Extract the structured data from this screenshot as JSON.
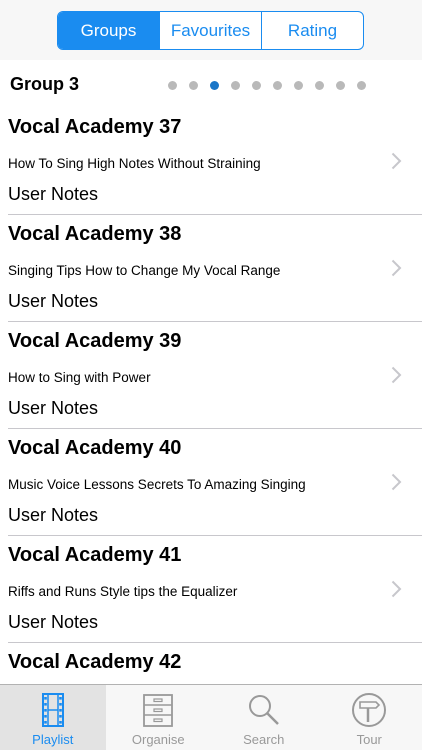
{
  "segments": [
    {
      "label": "Groups",
      "active": true
    },
    {
      "label": "Favourites",
      "active": false
    },
    {
      "label": "Rating",
      "active": false
    }
  ],
  "group": {
    "title": "Group 3",
    "page_count": 10,
    "current_page": 3
  },
  "rows": [
    {
      "title": "Vocal Academy 37",
      "subtitle": "How To Sing High Notes Without Straining",
      "notes": "User Notes"
    },
    {
      "title": "Vocal Academy 38",
      "subtitle": "Singing Tips  How to Change My Vocal Range",
      "notes": "User Notes"
    },
    {
      "title": "Vocal Academy 39",
      "subtitle": "How to Sing with Power",
      "notes": "User Notes"
    },
    {
      "title": "Vocal Academy 40",
      "subtitle": "Music Voice Lessons  Secrets To Amazing Singing",
      "notes": "User Notes"
    },
    {
      "title": "Vocal Academy 41",
      "subtitle": "Riffs and Runs Style tips the Equalizer",
      "notes": "User Notes"
    },
    {
      "title": "Vocal Academy 42"
    }
  ],
  "tabs": [
    {
      "label": "Playlist",
      "icon": "film-strip-icon",
      "active": true
    },
    {
      "label": "Organise",
      "icon": "cabinet-icon",
      "active": false
    },
    {
      "label": "Search",
      "icon": "magnifier-icon",
      "active": false
    },
    {
      "label": "Tour",
      "icon": "signpost-icon",
      "active": false
    }
  ],
  "colors": {
    "accent": "#1a8cf0",
    "inactive_tab": "#999999"
  }
}
